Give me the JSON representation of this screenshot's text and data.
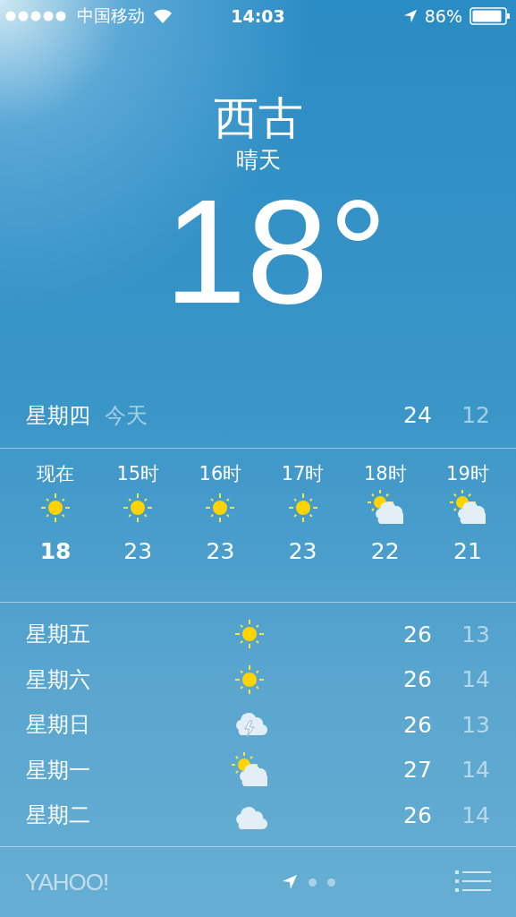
{
  "status_bar": {
    "carrier": "中国移动",
    "time": "14:03",
    "battery": "86%"
  },
  "city": "西古",
  "condition": "晴天",
  "temperature": "18°",
  "today": {
    "day": "星期四",
    "label": "今天",
    "high": "24",
    "low": "12"
  },
  "hourly": [
    {
      "time": "现在",
      "kind": "sun",
      "temp": "18",
      "now": true
    },
    {
      "time": "15时",
      "kind": "sun",
      "temp": "23",
      "now": false
    },
    {
      "time": "16时",
      "kind": "sun",
      "temp": "23",
      "now": false
    },
    {
      "time": "17时",
      "kind": "sun",
      "temp": "23",
      "now": false
    },
    {
      "time": "18时",
      "kind": "partly-cloudy",
      "temp": "22",
      "now": false
    },
    {
      "time": "19时",
      "kind": "partly-cloudy",
      "temp": "21",
      "now": false
    }
  ],
  "daily": [
    {
      "day": "星期五",
      "kind": "sun",
      "high": "26",
      "low": "13"
    },
    {
      "day": "星期六",
      "kind": "sun",
      "high": "26",
      "low": "14"
    },
    {
      "day": "星期日",
      "kind": "thunder",
      "high": "26",
      "low": "13"
    },
    {
      "day": "星期一",
      "kind": "partly-cloudy",
      "high": "27",
      "low": "14"
    },
    {
      "day": "星期二",
      "kind": "cloudy",
      "high": "26",
      "low": "14"
    }
  ],
  "footer": {
    "logo": "YAHOO!",
    "pages": [
      {
        "kind": "location",
        "selected": true
      },
      {
        "kind": "dot",
        "selected": false
      },
      {
        "kind": "dot",
        "selected": false
      }
    ]
  }
}
